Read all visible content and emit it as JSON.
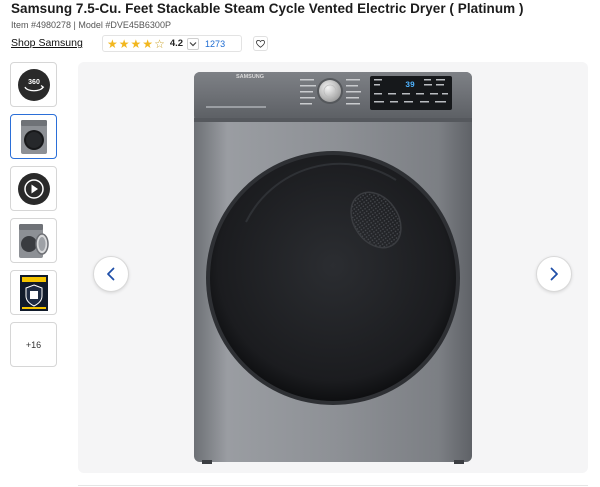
{
  "product": {
    "title": "Samsung 7.5-Cu. Feet Stackable Steam Cycle Vented Electric Dryer ( Platinum )",
    "meta": "Item #4980278 | Model #DVE45B6300P",
    "brand_link": "Shop Samsung"
  },
  "rating": {
    "value": "4.2",
    "stars_filled": 4,
    "stars_total": 5,
    "review_count": "1273",
    "star_color": "#f2b71e"
  },
  "icons": {
    "wishlist": "heart-icon",
    "expand": "chevron-down-icon",
    "prev": "chevron-left-icon",
    "next": "chevron-right-icon"
  },
  "gallery": {
    "thumb_360_label": "360",
    "more_label": "+16",
    "accent": "#2b6fd8"
  },
  "appliance": {
    "brand_mark": "SAMSUNG",
    "display_time": "39"
  }
}
